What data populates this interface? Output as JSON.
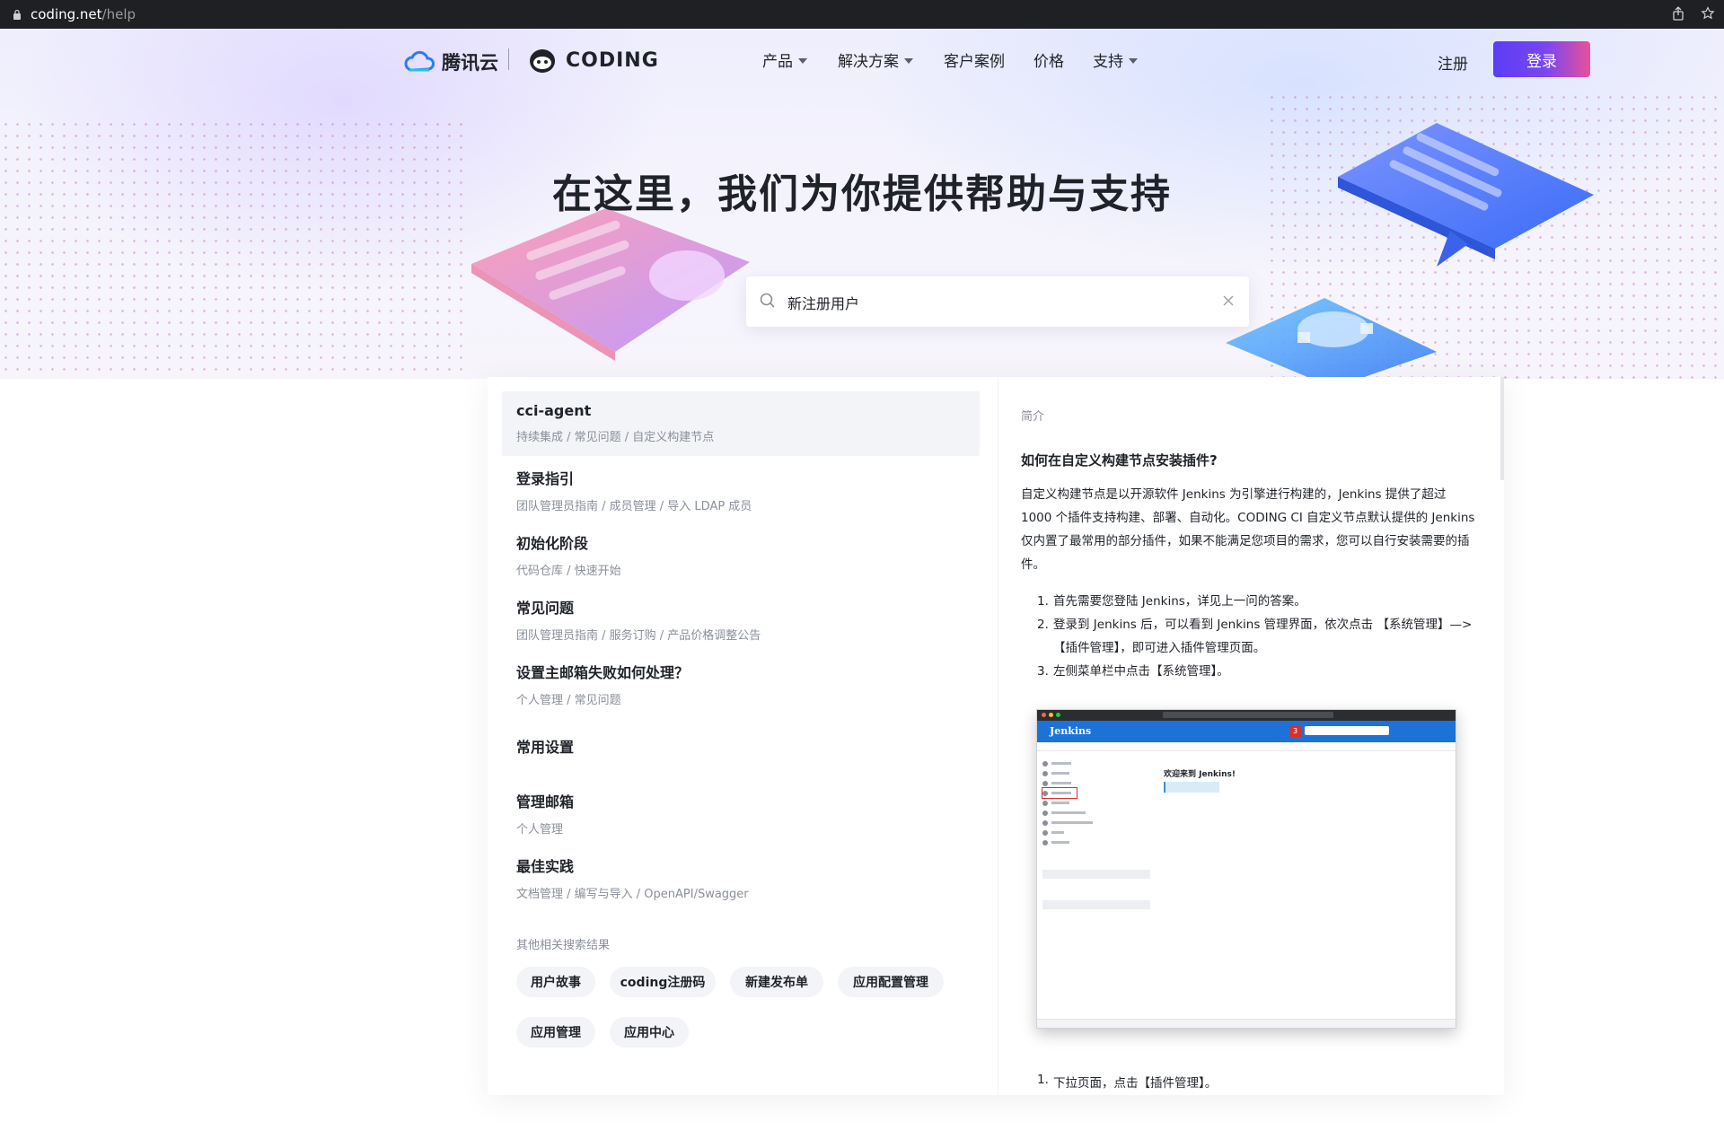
{
  "browser": {
    "host": "coding.net",
    "path": "/help"
  },
  "nav": {
    "brand_tencent": "腾讯云",
    "brand_coding": "CODING",
    "menu": [
      {
        "label": "产品",
        "dropdown": true
      },
      {
        "label": "解决方案",
        "dropdown": true
      },
      {
        "label": "客户案例",
        "dropdown": false
      },
      {
        "label": "价格",
        "dropdown": false
      },
      {
        "label": "支持",
        "dropdown": true
      }
    ],
    "register_label": "注册",
    "login_label": "登录"
  },
  "hero": {
    "title": "在这里，我们为你提供帮助与支持"
  },
  "search": {
    "value": "新注册用户"
  },
  "results": [
    {
      "title": "cci-agent",
      "path": "持续集成 / 常见问题 / 自定义构建节点",
      "active": true
    },
    {
      "title": "登录指引",
      "path": "团队管理员指南 / 成员管理 / 导入 LDAP 成员"
    },
    {
      "title": "初始化阶段",
      "path": "代码仓库 / 快速开始"
    },
    {
      "title": "常见问题",
      "path": "团队管理员指南 / 服务订购 / 产品价格调整公告"
    },
    {
      "title": "设置主邮箱失败如何处理？",
      "path": "个人管理 / 常见问题"
    },
    {
      "title": "常用设置",
      "path": ""
    },
    {
      "title": "管理邮箱",
      "path": "个人管理"
    },
    {
      "title": "最佳实践",
      "path": "文档管理 / 编写与导入 / OpenAPI/Swagger"
    }
  ],
  "other_results_label": "其他相关搜索结果",
  "tags": [
    "用户故事",
    "coding注册码",
    "新建发布单",
    "应用配置管理",
    "应用管理",
    "应用中心"
  ],
  "detail": {
    "section_label": "简介",
    "title": "如何在自定义构建节点安装插件?",
    "paragraph": "自定义构建节点是以开源软件 Jenkins 为引擎进行构建的，Jenkins 提供了超过 1000 个插件支持构建、部署、自动化。CODING CI 自定义节点默认提供的 Jenkins 仅内置了最常用的部分插件，如果不能满足您项目的需求，您可以自行安装需要的插件。",
    "steps": [
      {
        "num": "1.",
        "text": "首先需要您登陆 Jenkins，详见上一问的答案。"
      },
      {
        "num": "2.",
        "text": "登录到 Jenkins 后，可以看到 Jenkins 管理界面，依次点击 【系统管理】—>【插件管理】，即可进入插件管理页面。"
      },
      {
        "num": "3.",
        "text": "左侧菜单栏中点击【系统管理】。"
      }
    ],
    "screenshot": {
      "app_name": "Jenkins",
      "badge": "3",
      "welcome": "欢迎来到 Jenkins!"
    },
    "bottom_step": {
      "num": "1.",
      "text": "下拉页面，点击【插件管理】。"
    }
  },
  "colors": {
    "login_gradient_start": "#5b3df5",
    "login_gradient_end": "#e94f9b",
    "jenkins_blue": "#1d72d8",
    "highlight_red": "#d7302a"
  }
}
